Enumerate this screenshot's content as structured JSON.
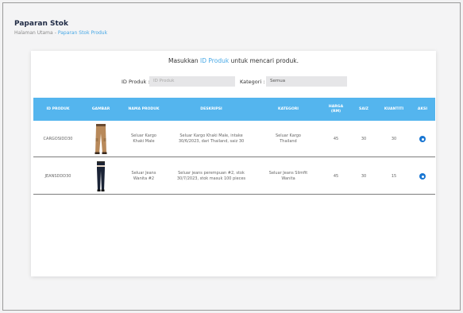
{
  "header": {
    "title": "Paparan Stok",
    "breadcrumb_home": "Halaman Utama",
    "breadcrumb_separator": "-",
    "breadcrumb_current": "Paparan Stok Produk"
  },
  "search": {
    "prompt_before": "Masukkan",
    "prompt_highlight": "ID Produk",
    "prompt_after": "untuk mencari produk.",
    "id_label": "ID Produk :",
    "id_placeholder": "ID Produk",
    "category_label": "Kategori :",
    "category_value": "Semua"
  },
  "table": {
    "headers": [
      "ID PRODUK",
      "GAMBAR",
      "NAMA PRODUK",
      "DESKRIPSI",
      "KATEGORI",
      "HARGA (RM)",
      "SAIZ",
      "KUANTITI",
      "AKSI"
    ],
    "rows": [
      {
        "id": "CARGOSIDD30",
        "image_icon": "khaki-cargo-pants-photo",
        "name": "Seluar Kargo Khaki Male",
        "description": "Seluar Kargo Khaki Male, intake 30/6/2023, dari Thailand, saiz 30",
        "category": "Seluar Kargo Thailand",
        "price": "45",
        "size": "30",
        "quantity": "30",
        "action_icon": "eye-icon"
      },
      {
        "id": "JEANSDDD30",
        "image_icon": "dark-skinny-jeans-photo",
        "name": "Seluar Jeans Wanita #2",
        "description": "Seluar jeans perempuan #2, stok 30/7/2023, stok masuk 100 pieces",
        "category": "Seluar Jeans Slimfit Wanita",
        "price": "45",
        "size": "30",
        "quantity": "15",
        "action_icon": "eye-icon"
      }
    ]
  },
  "colors": {
    "accent": "#47a8e6",
    "table_header": "#54b5ee",
    "action_icon": "#1976d2"
  }
}
